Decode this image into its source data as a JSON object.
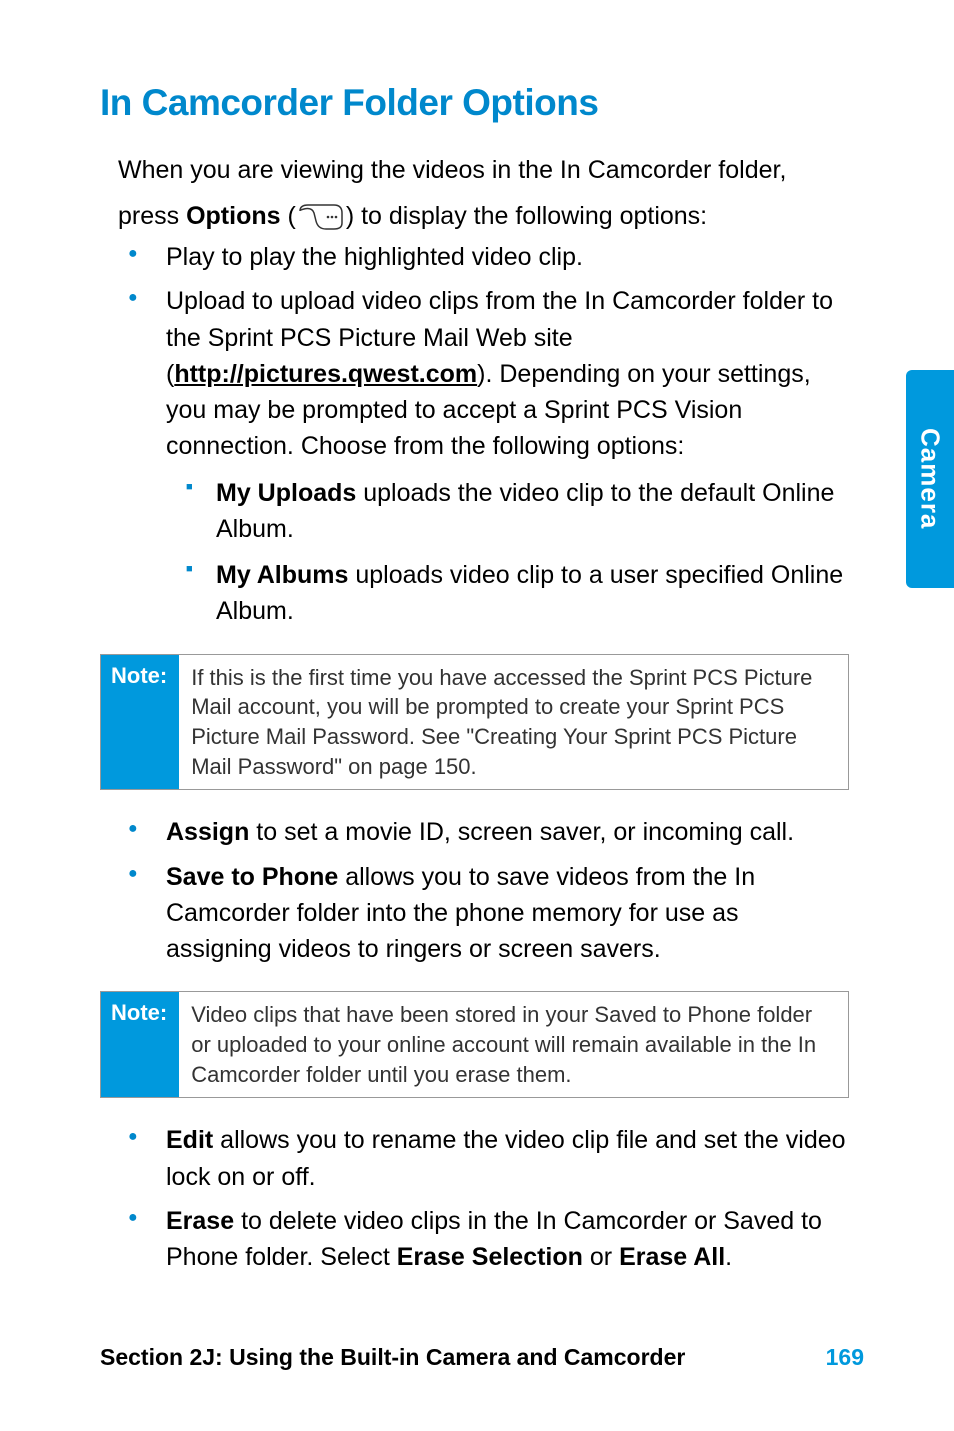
{
  "heading": "In Camcorder Folder Options",
  "intro": {
    "line1": "When you are viewing the videos in the In Camcorder folder,",
    "line2_before": "press ",
    "line2_bold": "Options",
    "line2_after": " to display the following options:"
  },
  "bullets": {
    "play": "Play to play the highlighted video clip.",
    "upload": {
      "text_before": "Upload to upload video clips from the In Camcorder folder to the Sprint PCS Picture Mail Web site (",
      "link": "http://pictures.qwest.com",
      "text_after": "). Depending on your settings, you may be prompted to accept a Sprint PCS Vision connection. Choose from the following options:",
      "sub": {
        "myuploads_bold": "My Uploads",
        "myuploads_text": " uploads the video clip to the default Online Album.",
        "myalbums_bold": "My Albums",
        "myalbums_text": " uploads video clip to a user specified Online Album."
      }
    },
    "assign_bold": "Assign",
    "assign_text": " to set a movie ID, screen saver, or incoming call.",
    "save_bold": "Save to Phone",
    "save_text": " allows you to save videos from the In Camcorder folder into the phone memory for use as assigning videos to ringers or screen savers.",
    "edit_bold": "Edit",
    "edit_text": " allows you to rename the video clip file and set the video lock on or off.",
    "erase_bold": "Erase",
    "erase_text1": " to delete video clips in the In Camcorder or Saved to Phone folder. Select ",
    "erase_sel_bold": "Erase Selection",
    "erase_or": " or ",
    "erase_all_bold": "Erase All",
    "erase_period": "."
  },
  "notes": {
    "label": "Note:",
    "note1": "If this is the first time you have accessed the Sprint PCS Picture Mail account, you will be prompted to create your Sprint PCS Picture Mail Password. See \"Creating Your Sprint PCS Picture Mail Password\" on page 150.",
    "note2": "Video clips that have been stored in your Saved to Phone folder or uploaded to your online account will remain available in the In Camcorder folder until you erase them."
  },
  "sidetab": "Camera",
  "footer": {
    "section": "Section 2J: Using the Built-in Camera and Camcorder",
    "page": "169"
  }
}
